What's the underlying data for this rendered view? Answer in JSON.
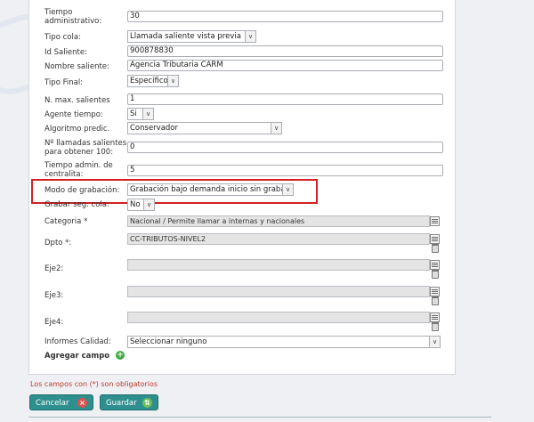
{
  "form": {
    "tiempo_administrativo": {
      "label_1": "Tiempo",
      "label_2": "administrativo:",
      "value": "30"
    },
    "tipo_cola": {
      "label": "Tipo cola:",
      "value": "Llamada saliente vista previa"
    },
    "id_saliente": {
      "label": "Id Saliente:",
      "value": "900878830"
    },
    "nombre_saliente": {
      "label": "Nombre saliente:",
      "value": "Agencia Tributaria CARM"
    },
    "tipo_final": {
      "label": "Tipo Final:",
      "value": "Especifico"
    },
    "max_salientes": {
      "label": "N. max. salientes",
      "value": "1"
    },
    "agente_tiempo": {
      "label": "Agente tiempo:",
      "value": "Si"
    },
    "algoritmo": {
      "label": "Algoritmo predic.",
      "value": "Conservador"
    },
    "llamadas": {
      "label_1": "Nº llamadas salientes",
      "label_2": "para obtener 100:",
      "value": "0"
    },
    "tiempo_centralita": {
      "label_1": "Tiempo admin. de",
      "label_2": "centralita:",
      "value": "5"
    },
    "modo_grabacion": {
      "label": "Modo de grabación:",
      "value": "Grabación bajo demanda inicio sin grabar"
    },
    "grabar_seg_cola": {
      "label": "Grabar seg. cola:",
      "value": "No"
    },
    "categoria": {
      "label": "Categoria *",
      "value": "Nacional / Permite llamar a internas y nacionales"
    },
    "dpto": {
      "label": "Dpto *:",
      "value": "CC-TRIBUTOS-NIVEL2"
    },
    "eje2": {
      "label": "Eje2:",
      "value": ""
    },
    "eje3": {
      "label": "Eje3:",
      "value": ""
    },
    "eje4": {
      "label": "Eje4:",
      "value": ""
    },
    "informes_calidad": {
      "label": "Informes Calidad:",
      "value": "Seleccionar ninguno"
    },
    "agregar_campo": "Agregar campo"
  },
  "required_note": "Los campos con (*) son obligatorios",
  "buttons": {
    "cancel": "Cancelar",
    "save": "Guardar"
  },
  "icons": {
    "add": "plus-circle-icon",
    "cancel": "cancel-icon",
    "save": "save-icon",
    "list": "list-icon",
    "trash": "trash-icon"
  },
  "colors": {
    "highlight": "#d42020",
    "button": "#2f8e8e",
    "required_text": "#c0392b"
  }
}
